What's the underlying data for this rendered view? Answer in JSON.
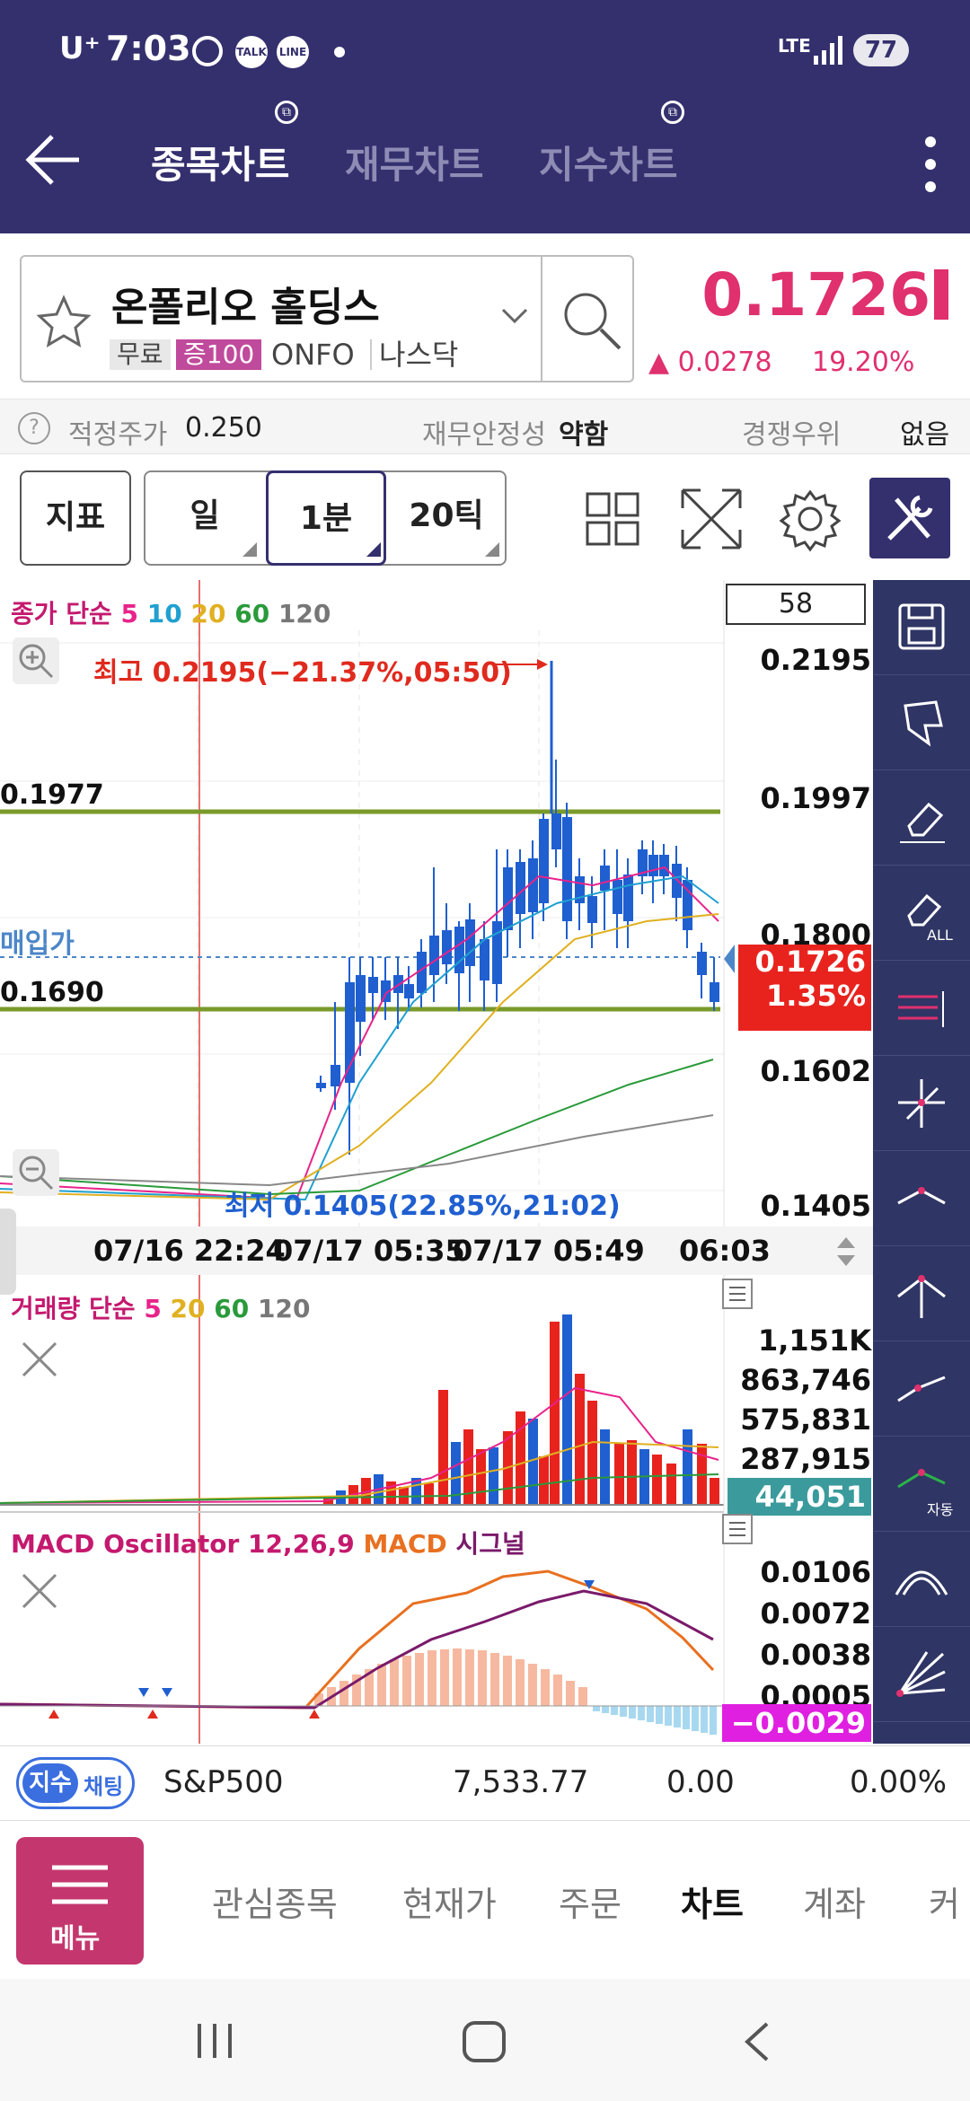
{
  "status_bar": {
    "carrier": "U⁺",
    "time": "7:03",
    "icon_talk": "TALK",
    "icon_line": "LINE",
    "network": "LTE",
    "battery": "77"
  },
  "header": {
    "tabs": [
      {
        "label": "종목차트",
        "active": true
      },
      {
        "label": "재무차트",
        "active": false
      },
      {
        "label": "지수차트",
        "active": false
      }
    ]
  },
  "stock": {
    "name": "온폴리오 홀딩스",
    "tags": [
      "무료",
      "증100",
      "ONFO",
      "나스닥"
    ],
    "price": "0.1726",
    "change": "▲ 0.0278",
    "change_pct": "19.20%"
  },
  "info_row": {
    "fair_price_label": "적정주가",
    "fair_price_value": "0.250",
    "fin_stability_label": "재무안정성",
    "fin_stability_value": "약함",
    "competitive_label": "경쟁우위",
    "competitive_value": "없음"
  },
  "toolbar": {
    "indicator": "지표",
    "day": "일",
    "minute": "1분",
    "tick": "20틱"
  },
  "price_pane": {
    "legend_title": "종가 단순",
    "ma_labels": [
      "5",
      "10",
      "20",
      "60",
      "120"
    ],
    "count_box": "58",
    "high_label": "최고 0.2195(−21.37%,05:50)",
    "low_label": "최저 0.1405(22.85%,21:02)",
    "line_high": "0.1977",
    "line_low": "0.1690",
    "buy_label": "매입가",
    "current_price": "0.1726",
    "current_pct": "1.35%",
    "y_ticks": [
      "0.2195",
      "0.1997",
      "0.1800",
      "0.1602",
      "0.1405"
    ],
    "x_ticks": [
      "07/16 22:24",
      "07/17 05:35",
      "07/17 05:49",
      "06:03"
    ]
  },
  "volume_pane": {
    "legend_title": "거래량 단순",
    "ma_labels": [
      "5",
      "20",
      "60",
      "120"
    ],
    "y_ticks": [
      "1,151K",
      "863,746",
      "575,831",
      "287,915"
    ],
    "current": "44,051"
  },
  "macd_pane": {
    "legend_osc": "MACD Oscillator 12,26,9",
    "legend_macd": "MACD",
    "legend_signal": "시그널",
    "y_ticks": [
      "0.0106",
      "0.0072",
      "0.0038",
      "0.0005"
    ],
    "current": "−0.0029"
  },
  "sidebar_all": "ALL",
  "sidebar_auto": "자동",
  "index_bar": {
    "badge1": "지수",
    "badge2": "채팅",
    "name": "S&P500",
    "value": "7,533.77",
    "change": "0.00",
    "pct": "0.00%"
  },
  "bottom_nav": {
    "menu": "메뉴",
    "items": [
      "관심종목",
      "현재가",
      "주문",
      "차트",
      "계좌",
      "커"
    ]
  },
  "colors": {
    "header": "#34306e",
    "price_up": "#e0306e",
    "candle_up": "#e8231e",
    "candle_down": "#1f5fd0",
    "sidebar": "#2f3564"
  }
}
